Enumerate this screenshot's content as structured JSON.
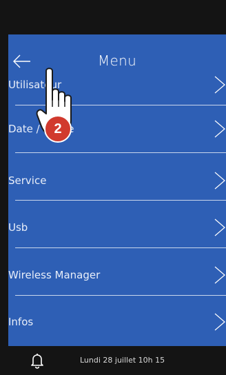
{
  "header": {
    "title": "Menu"
  },
  "menu": {
    "items": [
      {
        "label": "Utilisateur"
      },
      {
        "label": "Date / Heure"
      },
      {
        "label": "Service"
      },
      {
        "label": "Usb"
      },
      {
        "label": "Wireless Manager"
      },
      {
        "label": "Infos"
      }
    ]
  },
  "status_bar": {
    "datetime": "Lundi 28 juillet 10h 15"
  },
  "annotation": {
    "step_number": "2"
  },
  "colors": {
    "screen_bg": "#2e5fb5",
    "bezel": "#141414",
    "badge": "#d13a2e"
  },
  "icons": {
    "back": "arrow-left-icon",
    "chevron": "chevron-right-icon",
    "bell": "bell-icon",
    "pointer": "pointing-hand-icon"
  }
}
